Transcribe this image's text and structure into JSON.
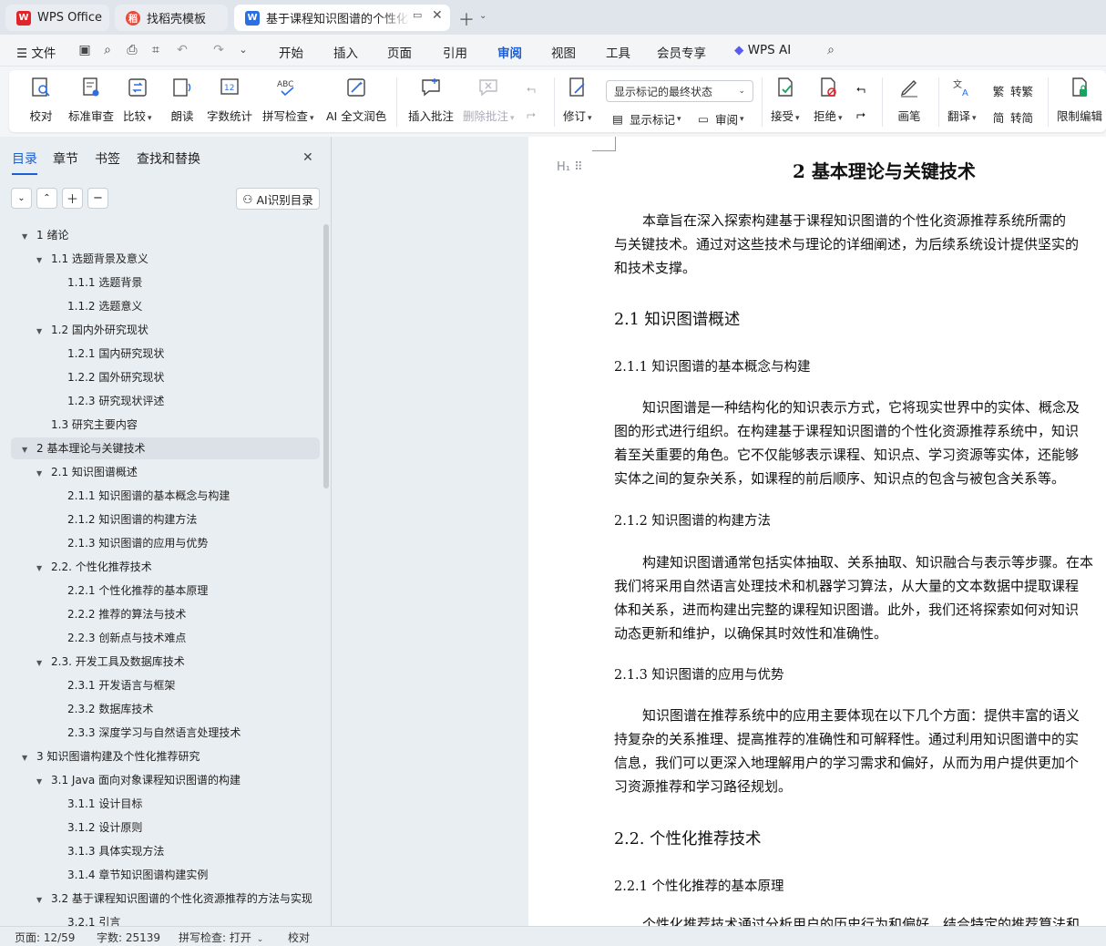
{
  "tabs": [
    {
      "label": "WPS Office",
      "icon": "wps-logo-icon"
    },
    {
      "label": "找稻壳模板",
      "icon": "docer-icon"
    },
    {
      "label": "基于课程知识图谱的个性化资源推荐系统",
      "icon": "word-doc-icon"
    }
  ],
  "menu": {
    "file": "文件",
    "items": [
      "开始",
      "插入",
      "页面",
      "引用",
      "审阅",
      "视图",
      "工具",
      "会员专享"
    ],
    "wps_ai": "WPS AI"
  },
  "ribbon": {
    "proofread": "校对",
    "standard_review": "标准审查",
    "compare": "比较",
    "read_aloud": "朗读",
    "word_count": "字数统计",
    "spell_check": "拼写检查",
    "ai_proofread": "AI 全文润色",
    "insert_comment": "插入批注",
    "delete_comment": "删除批注",
    "markup_select": "显示标记的最终状态",
    "track": "修订",
    "show_markup": "显示标记",
    "review_pane": "审阅",
    "accept": "接受",
    "reject": "拒绝",
    "pen": "画笔",
    "translate": "翻译",
    "to_traditional": "转繁",
    "to_simplified": "转简",
    "restrict_edit": "限制编辑"
  },
  "left_panel": {
    "tabs": [
      "目录",
      "章节",
      "书签",
      "查找和替换"
    ],
    "ai_button": "AI识别目录",
    "toc": [
      {
        "level": 0,
        "label": "1  绪论",
        "expanded": true
      },
      {
        "level": 1,
        "label": "1.1  选题背景及意义",
        "expanded": true
      },
      {
        "level": 2,
        "label": "1.1.1  选题背景"
      },
      {
        "level": 2,
        "label": "1.1.2  选题意义"
      },
      {
        "level": 1,
        "label": "1.2  国内外研究现状",
        "expanded": true
      },
      {
        "level": 2,
        "label": "1.2.1  国内研究现状"
      },
      {
        "level": 2,
        "label": "1.2.2  国外研究现状"
      },
      {
        "level": 2,
        "label": "1.2.3  研究现状评述"
      },
      {
        "level": 1,
        "label": "1.3  研究主要内容"
      },
      {
        "level": 0,
        "label": "2  基本理论与关键技术",
        "expanded": true,
        "selected": true
      },
      {
        "level": 1,
        "label": "2.1  知识图谱概述",
        "expanded": true
      },
      {
        "level": 2,
        "label": "2.1.1  知识图谱的基本概念与构建"
      },
      {
        "level": 2,
        "label": "2.1.2  知识图谱的构建方法"
      },
      {
        "level": 2,
        "label": "2.1.3  知识图谱的应用与优势"
      },
      {
        "level": 1,
        "label": "2.2.  个性化推荐技术",
        "expanded": true
      },
      {
        "level": 2,
        "label": "2.2.1  个性化推荐的基本原理"
      },
      {
        "level": 2,
        "label": "2.2.2  推荐的算法与技术"
      },
      {
        "level": 2,
        "label": "2.2.3  创新点与技术难点"
      },
      {
        "level": 1,
        "label": "2.3.  开发工具及数据库技术",
        "expanded": true
      },
      {
        "level": 2,
        "label": "2.3.1  开发语言与框架"
      },
      {
        "level": 2,
        "label": "2.3.2  数据库技术"
      },
      {
        "level": 2,
        "label": "2.3.3  深度学习与自然语言处理技术"
      },
      {
        "level": 0,
        "label": "3  知识图谱构建及个性化推荐研究",
        "expanded": true
      },
      {
        "level": 1,
        "label": "3.1 Java 面向对象课程知识图谱的构建",
        "expanded": true
      },
      {
        "level": 2,
        "label": "3.1.1  设计目标"
      },
      {
        "level": 2,
        "label": "3.1.2  设计原则"
      },
      {
        "level": 2,
        "label": "3.1.3  具体实现方法"
      },
      {
        "level": 2,
        "label": "3.1.4  章节知识图谱构建实例"
      },
      {
        "level": 1,
        "label": "3.2  基于课程知识图谱的个性化资源推荐的方法与实现",
        "expanded": true
      },
      {
        "level": 2,
        "label": "3.2.1  引言"
      }
    ]
  },
  "document": {
    "h1": "2  基本理论与关键技术",
    "intro": [
      "本章旨在深入探索构建基于课程知识图谱的个性化资源推荐系统所需的",
      "与关键技术。通过对这些技术与理论的详细阐述，为后续系统设计提供坚实的",
      "和技术支撑。"
    ],
    "h2_1": "2.1  知识图谱概述",
    "h3_1": "2.1.1  知识图谱的基本概念与构建",
    "p1": [
      "知识图谱是一种结构化的知识表示方式，它将现实世界中的实体、概念及",
      "图的形式进行组织。在构建基于课程知识图谱的个性化资源推荐系统中，知识",
      "着至关重要的角色。它不仅能够表示课程、知识点、学习资源等实体，还能够",
      "实体之间的复杂关系，如课程的前后顺序、知识点的包含与被包含关系等。"
    ],
    "h3_2": "2.1.2  知识图谱的构建方法",
    "p2": [
      "构建知识图谱通常包括实体抽取、关系抽取、知识融合与表示等步骤。在本",
      "我们将采用自然语言处理技术和机器学习算法，从大量的文本数据中提取课程",
      "体和关系，进而构建出完整的课程知识图谱。此外，我们还将探索如何对知识",
      "动态更新和维护，以确保其时效性和准确性。"
    ],
    "h3_3": "2.1.3  知识图谱的应用与优势",
    "p3": [
      "知识图谱在推荐系统中的应用主要体现在以下几个方面：提供丰富的语义",
      "持复杂的关系推理、提高推荐的准确性和可解释性。通过利用知识图谱中的实",
      "信息，我们可以更深入地理解用户的学习需求和偏好，从而为用户提供更加个",
      "习资源推荐和学习路径规划。"
    ],
    "h2_2": "2.2.  个性化推荐技术",
    "h3_4": "2.2.1  个性化推荐的基本原理",
    "p4_cut": "个性化推荐技术通过分析用户的历史行为和偏好，结合特定的推荐算法和"
  },
  "status": {
    "page": "页面: 12/59",
    "words": "字数: 25139",
    "spell": "拼写检查: 打开",
    "proof": "校对"
  },
  "colors": {
    "accent": "#1a5fd6",
    "wps_red": "#e0242a",
    "word_blue": "#2b6fe0"
  }
}
